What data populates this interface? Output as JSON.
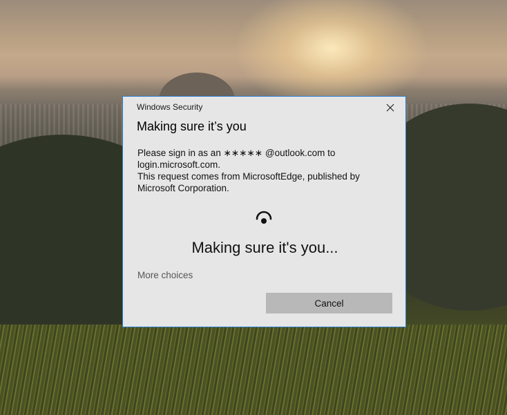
{
  "dialog": {
    "caption": "Windows Security",
    "heading": "Making sure it’s you",
    "sign_in_text": "Please sign in as an ∗∗∗∗∗ @outlook.com to login.microsoft.com.",
    "request_text": "This request comes from MicrosoftEdge, published by Microsoft Corporation.",
    "status_text": "Making sure it's you...",
    "more_choices_label": "More choices",
    "cancel_label": "Cancel",
    "close_icon": "close-icon",
    "spinner_icon": "spinner-icon"
  },
  "colors": {
    "dialog_bg": "#e6e6e6",
    "dialog_border": "#2a7fd4",
    "cancel_bg": "#b8b8b8",
    "link_text": "#555555"
  }
}
